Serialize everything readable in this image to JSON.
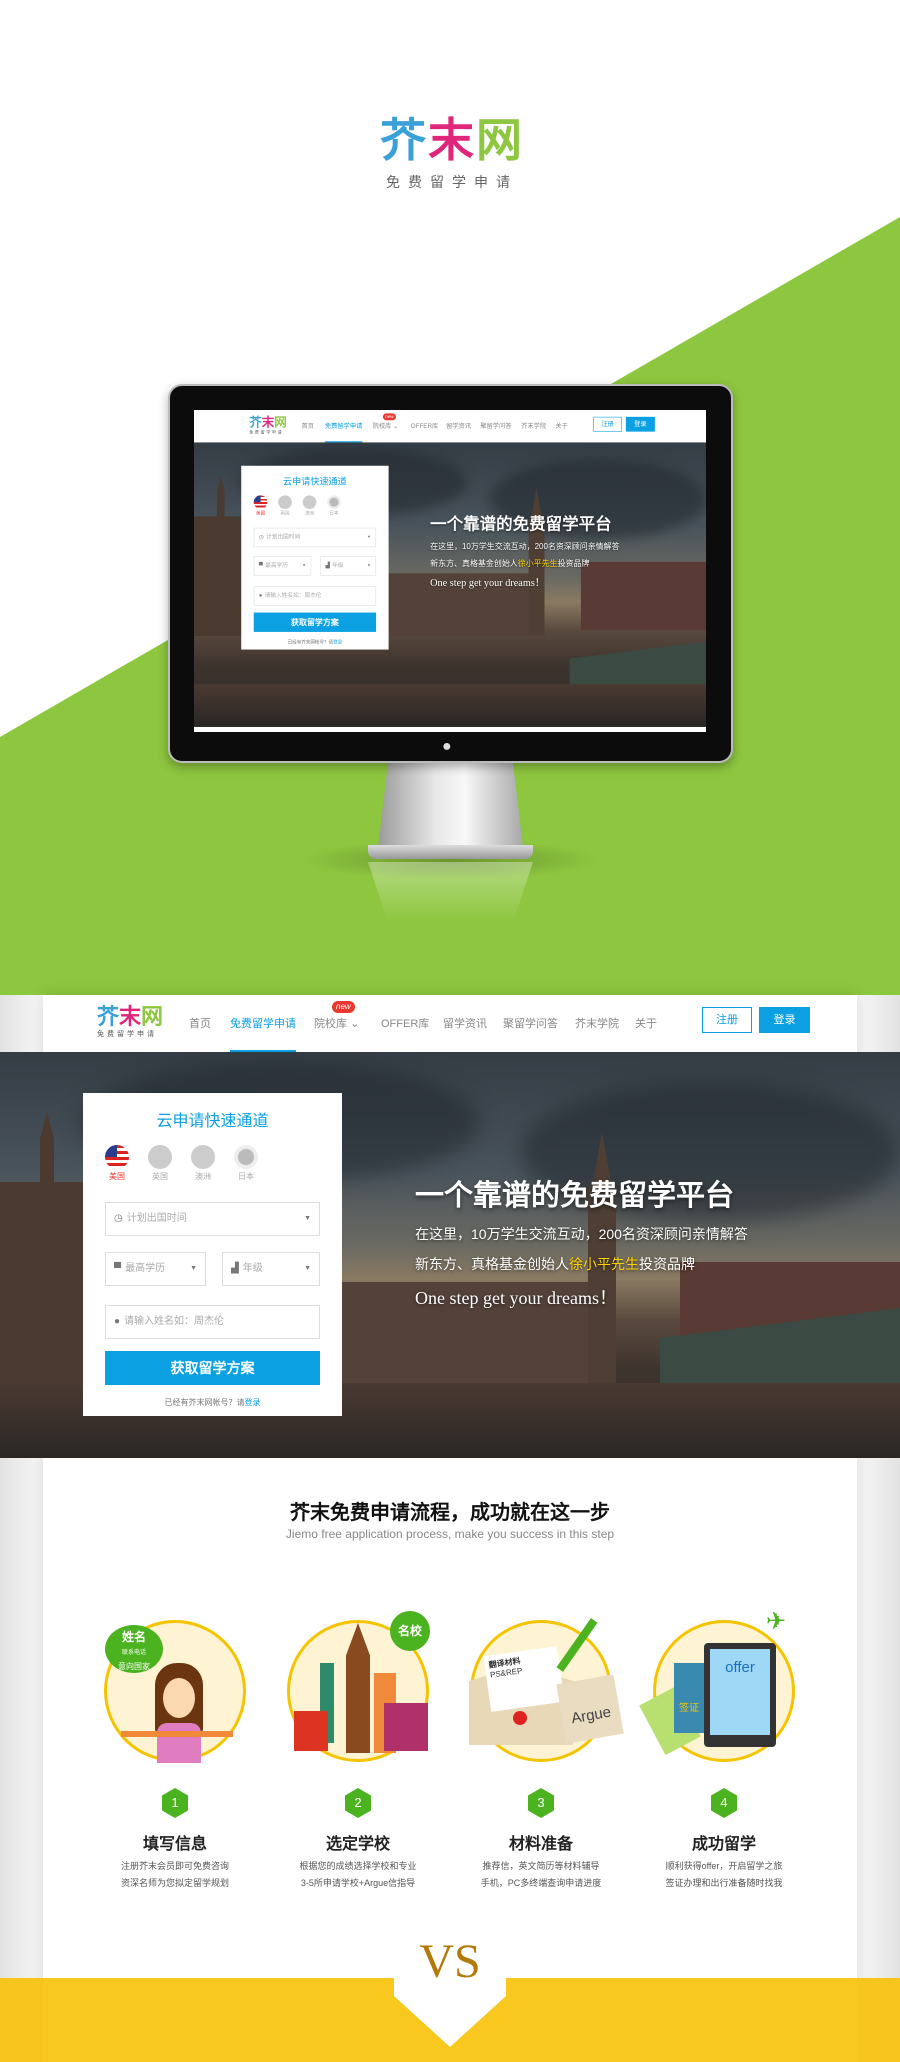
{
  "brand": {
    "name": [
      "芥",
      "末",
      "网"
    ],
    "tagline": "免费留学申请"
  },
  "nav": {
    "items": [
      "首页",
      "免费留学申请",
      "院校库",
      "OFFER库",
      "留学资讯",
      "聚留学问答",
      "芥末学院",
      "关于"
    ],
    "badge": "new",
    "register": "注册",
    "login": "登录",
    "active": "免费留学申请"
  },
  "form": {
    "title": "云申请快速通道",
    "countries": [
      "美国",
      "英国",
      "澳洲",
      "日本"
    ],
    "selected_country": "美国",
    "time_placeholder": "计划出国时间",
    "edu_placeholder": "最高学历",
    "grade_placeholder": "年级",
    "name_placeholder": "请输入姓名如：周杰伦",
    "submit": "获取留学方案",
    "hint": "已经有芥末网帐号？请",
    "hint_link": "登录"
  },
  "hero": {
    "headline": "一个靠谱的免费留学平台",
    "line1": "在这里，10万学生交流互动，200名资深顾问亲情解答",
    "line2_pre": "新东方、真格基金创始人",
    "line2_hl": "徐小平先生",
    "line2_post": "投资品牌",
    "english": "One step get your dreams！"
  },
  "process": {
    "title": "芥末免费申请流程，成功就在这一步",
    "subtitle": "Jiemo free application process, make you success in this step",
    "steps": [
      {
        "num": "1",
        "title": "填写信息",
        "desc1": "注册芥末会员即可免费咨询",
        "desc2": "资深名师为您拟定留学规划",
        "tags": [
          "姓名",
          "联系电话",
          "意向国家"
        ]
      },
      {
        "num": "2",
        "title": "选定学校",
        "desc1": "根据您的成绩选择学校和专业",
        "desc2": "3-5所申请学校+Argue信指导",
        "tags": [
          "名校"
        ]
      },
      {
        "num": "3",
        "title": "材料准备",
        "desc1": "推荐信，英文简历等材料辅导",
        "desc2": "手机，PC多终端查询申请进度",
        "tags": [
          "翻译材料",
          "PS&REP",
          "Argue"
        ]
      },
      {
        "num": "4",
        "title": "成功留学",
        "desc1": "顺利获得offer，开启留学之旅",
        "desc2": "签证办理和出行准备随时找我",
        "tags": [
          "offer",
          "签证"
        ]
      }
    ]
  },
  "vs": "VS",
  "colors": {
    "accent": "#0aa0e2",
    "green": "#8dc63f",
    "step_green": "#4cb320",
    "yellow": "#f7c51c",
    "highlight": "#ffd200"
  }
}
